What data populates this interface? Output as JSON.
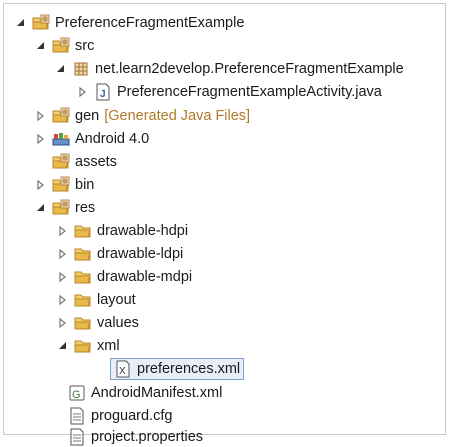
{
  "tree": {
    "project": {
      "label": "PreferenceFragmentExample"
    },
    "src": {
      "label": "src"
    },
    "package": {
      "label": "net.learn2develop.PreferenceFragmentExample"
    },
    "activity_file": {
      "label": "PreferenceFragmentExampleActivity.java"
    },
    "gen": {
      "label": "gen",
      "decoration": "[Generated Java Files]"
    },
    "android": {
      "label": "Android 4.0"
    },
    "assets": {
      "label": "assets"
    },
    "bin": {
      "label": "bin"
    },
    "res": {
      "label": "res"
    },
    "drawable_hdpi": {
      "label": "drawable-hdpi"
    },
    "drawable_ldpi": {
      "label": "drawable-ldpi"
    },
    "drawable_mdpi": {
      "label": "drawable-mdpi"
    },
    "layout": {
      "label": "layout"
    },
    "values": {
      "label": "values"
    },
    "xml": {
      "label": "xml"
    },
    "preferences": {
      "label": "preferences.xml"
    },
    "manifest": {
      "label": "AndroidManifest.xml"
    },
    "proguard": {
      "label": "proguard.cfg"
    },
    "project_props": {
      "label": "project.properties"
    }
  },
  "icons": {
    "expanded": "expanded-arrow-icon",
    "collapsed": "collapsed-arrow-icon",
    "folder": "folder-icon",
    "source_folder": "source-folder-icon",
    "package": "package-icon",
    "java_file": "java-file-icon",
    "library": "library-icon",
    "xml_file": "xml-file-icon",
    "text_file": "text-file-icon"
  },
  "colors": {
    "decoration": "#b07a2a",
    "selection_bg": "#e7eef8",
    "selection_border": "#7da2ce",
    "folder": "#e8b84a"
  }
}
